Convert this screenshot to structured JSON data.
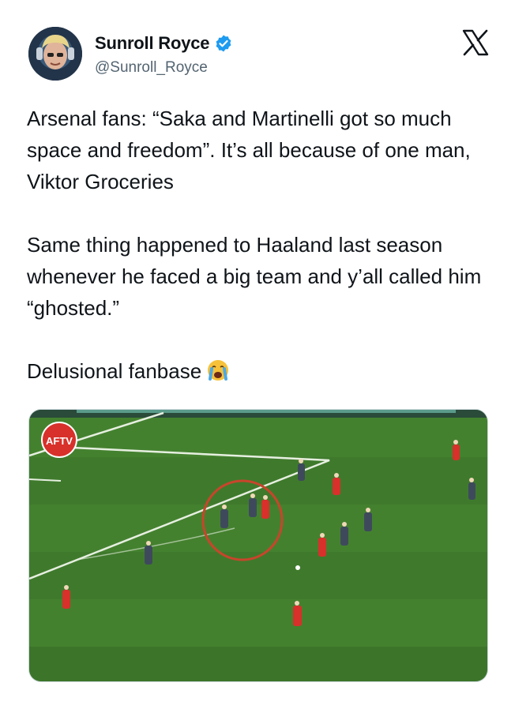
{
  "tweet": {
    "display_name": "Sunroll Royce",
    "handle": "@Sunroll_Royce",
    "paragraphs": [
      "Arsenal fans: “Saka and Martinelli got so much space and freedom”. It’s all because of one man, Viktor Groceries",
      "Same thing happened to Haaland last season whenever he faced a big team and y’all called him “ghosted.”",
      "Delusional fanbase"
    ],
    "emoji": "loudly-crying-face-icon"
  },
  "media": {
    "watermark": "AFTV",
    "colors": {
      "pitch": "#3f7a2c",
      "highlight_circle": "#c8452b",
      "arsenal_kit": "#d8302a",
      "opponent_kit": "#3e4a5c"
    }
  },
  "icons": {
    "verified": "verified-badge-icon",
    "platform": "x-logo-icon"
  },
  "colors": {
    "verified_blue": "#1d9bf0",
    "handle_gray": "#536471",
    "text": "#0f1419"
  }
}
